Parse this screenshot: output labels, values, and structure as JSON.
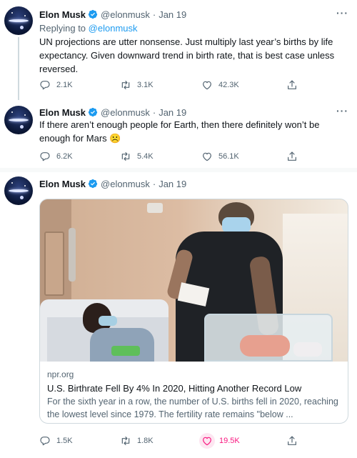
{
  "tweets": [
    {
      "name": "Elon Musk",
      "handle": "@elonmusk",
      "dot": "·",
      "date": "Jan 19",
      "replying_prefix": "Replying to",
      "replying_handle": "@elonmusk",
      "text": "UN projections are utter nonsense. Just multiply last year’s births by life expectancy. Given downward trend in birth rate, that is best case unless reversed.",
      "replies": "2.1K",
      "retweets": "3.1K",
      "likes": "42.3K"
    },
    {
      "name": "Elon Musk",
      "handle": "@elonmusk",
      "dot": "·",
      "date": "Jan 19",
      "text": "If there aren’t enough people for Earth, then there definitely won’t be enough for Mars ☹️",
      "replies": "6.2K",
      "retweets": "5.4K",
      "likes": "56.1K"
    },
    {
      "name": "Elon Musk",
      "handle": "@elonmusk",
      "dot": "·",
      "date": "Jan 19",
      "card": {
        "domain": "npr.org",
        "title": "U.S. Birthrate Fell By 4% In 2020, Hitting Another Record Low",
        "description": "For the sixth year in a row, the number of U.S. births fell in 2020, reaching the lowest level since 1979. The fertility rate remains \"below ..."
      },
      "replies": "1.5K",
      "retweets": "1.8K",
      "likes": "19.5K",
      "liked": true
    }
  ],
  "colors": {
    "text": "#0f1419",
    "secondary": "#536471",
    "link": "#1d9bf0",
    "like": "#f91880",
    "verified": "#1d9bf0",
    "divider": "#eff3f4"
  },
  "icons": [
    "verified-badge-icon",
    "more-icon",
    "reply-icon",
    "retweet-icon",
    "like-icon",
    "share-icon"
  ]
}
